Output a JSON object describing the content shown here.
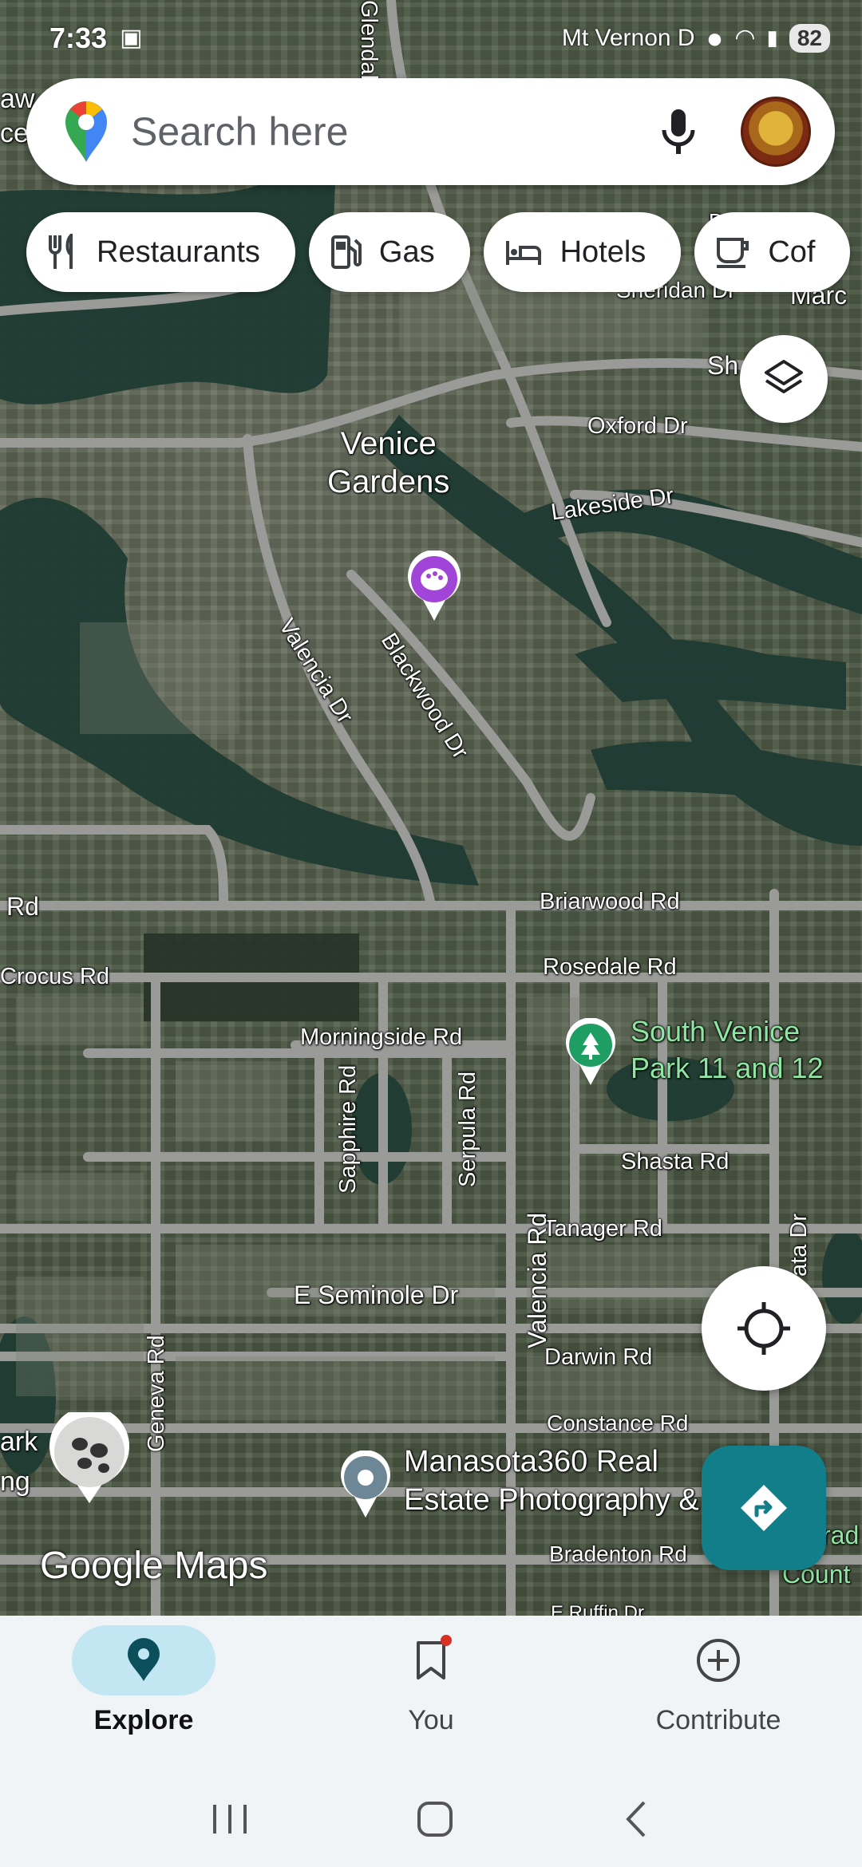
{
  "status_bar": {
    "time": "7:33",
    "location": "Mt Vernon D",
    "battery": "82"
  },
  "search": {
    "placeholder": "Search here"
  },
  "chips": [
    {
      "label": "Restaurants",
      "icon": "restaurant-icon"
    },
    {
      "label": "Gas",
      "icon": "gas-station-icon"
    },
    {
      "label": "Hotels",
      "icon": "hotel-bed-icon"
    },
    {
      "label": "Cof",
      "icon": "coffee-cup-icon"
    }
  ],
  "map": {
    "area_label": "Venice\nGardens",
    "streets": {
      "glendale": "Glendal",
      "sheridan": "Sheridan Dr",
      "dr_top": "Dr",
      "marco": "Marc",
      "shamrock": "Sh        k Bl",
      "oxford": "Oxford Dr",
      "lakeside": "Lakeside Dr",
      "valencia_dr": "Valencia Dr",
      "blackwood": "Blackwood Dr",
      "rd_left": "Rd",
      "briarwood": "Briarwood Rd",
      "crocus": "Crocus Rd",
      "rosedale": "Rosedale Rd",
      "morningside": "Morningside Rd",
      "sapphire": "Sapphire Rd",
      "serpula": "Serpula Rd",
      "shasta": "Shasta Rd",
      "tanager": "Tanager Rd",
      "ata_dr": "ata Dr",
      "valencia_rd": "Valencia Rd",
      "e_seminole": "E Seminole Dr",
      "darwin": "Darwin Rd",
      "constance": "Constance Rd",
      "geneva": "Geneva Rd",
      "bradenton": "Bradenton Rd",
      "e_ruffin": "E Ruffin Dr",
      "ark": "ark",
      "ng": "ng",
      "aw": "aw",
      "ce": "ce,",
      "rad": "rad",
      "count": "Count"
    },
    "pois": {
      "park": "South Venice\nPark 11 and 12",
      "realestate": "Manasota360 Real\nEstate Photography &"
    },
    "logo": "Google Maps"
  },
  "bottom_nav": [
    {
      "label": "Explore",
      "active": true
    },
    {
      "label": "You",
      "active": false
    },
    {
      "label": "Contribute",
      "active": false
    }
  ]
}
